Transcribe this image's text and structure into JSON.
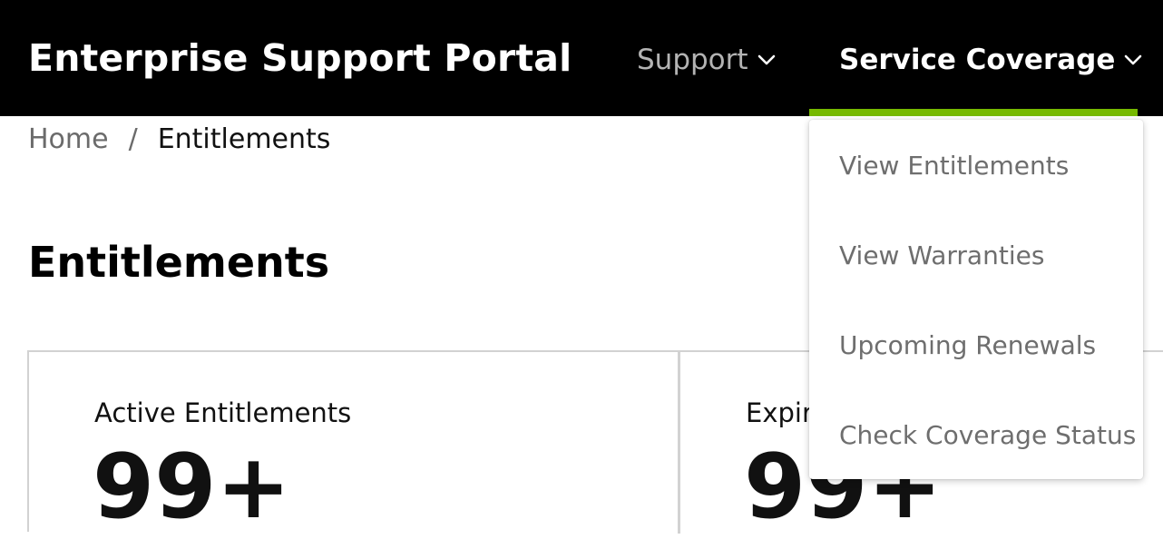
{
  "header": {
    "brand": "Enterprise Support Portal",
    "nav": [
      {
        "label": "Support",
        "icon": "chevron-down-icon"
      },
      {
        "label": "Service Coverage",
        "icon": "chevron-down-icon",
        "active": true
      }
    ],
    "accent_color": "#76b900"
  },
  "breadcrumb": {
    "home": "Home",
    "separator": "/",
    "current": "Entitlements"
  },
  "page": {
    "title": "Entitlements"
  },
  "cards": [
    {
      "label": "Active Entitlements",
      "value": "99+"
    },
    {
      "label": "Expiring Soon",
      "value": "99+"
    }
  ],
  "dropdown": {
    "items": [
      {
        "label": "View Entitlements"
      },
      {
        "label": "View Warranties"
      },
      {
        "label": "Upcoming Renewals"
      },
      {
        "label": "Check Coverage Status"
      }
    ]
  }
}
